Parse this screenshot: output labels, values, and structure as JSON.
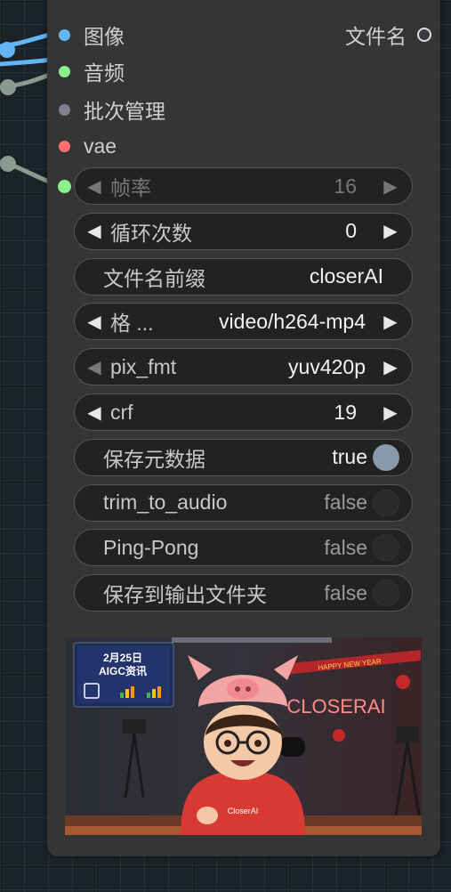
{
  "node": {
    "inputs": [
      {
        "label": "图像",
        "color": "#64b5f6"
      },
      {
        "label": "音频",
        "color": "#8cf08c"
      },
      {
        "label": "批次管理",
        "color": "#808090"
      },
      {
        "label": "vae",
        "color": "#ff6e6e"
      }
    ],
    "output": {
      "label": "文件名"
    },
    "widget_input_color": "#8cf08c"
  },
  "widgets": [
    {
      "label": "帧率",
      "value": "16",
      "type": "number",
      "disabled": true
    },
    {
      "label": "循环次数",
      "value": "0",
      "type": "number"
    },
    {
      "label": "文件名前缀",
      "value": "closerAI",
      "type": "text"
    },
    {
      "label": "格 ...",
      "value": "video/h264-mp4",
      "type": "combo"
    },
    {
      "label": "pix_fmt",
      "value": "yuv420p",
      "type": "combo",
      "left_dim": true
    },
    {
      "label": "crf",
      "value": "19",
      "type": "number"
    },
    {
      "label": "保存元数据",
      "value": "true",
      "type": "toggle",
      "on": true
    },
    {
      "label": "trim_to_audio",
      "value": "false",
      "type": "toggle",
      "on": false
    },
    {
      "label": "Ping-Pong",
      "value": "false",
      "type": "toggle",
      "on": false
    },
    {
      "label": "保存到输出文件夹",
      "value": "false",
      "type": "toggle",
      "on": false
    }
  ],
  "preview": {
    "screen_line1": "2月25日",
    "screen_line2": "AIGC资讯",
    "neon_sign": "CLOSERAI",
    "banner": "HAPPY NEW YEAR",
    "shirt_text": "CloserAI"
  }
}
